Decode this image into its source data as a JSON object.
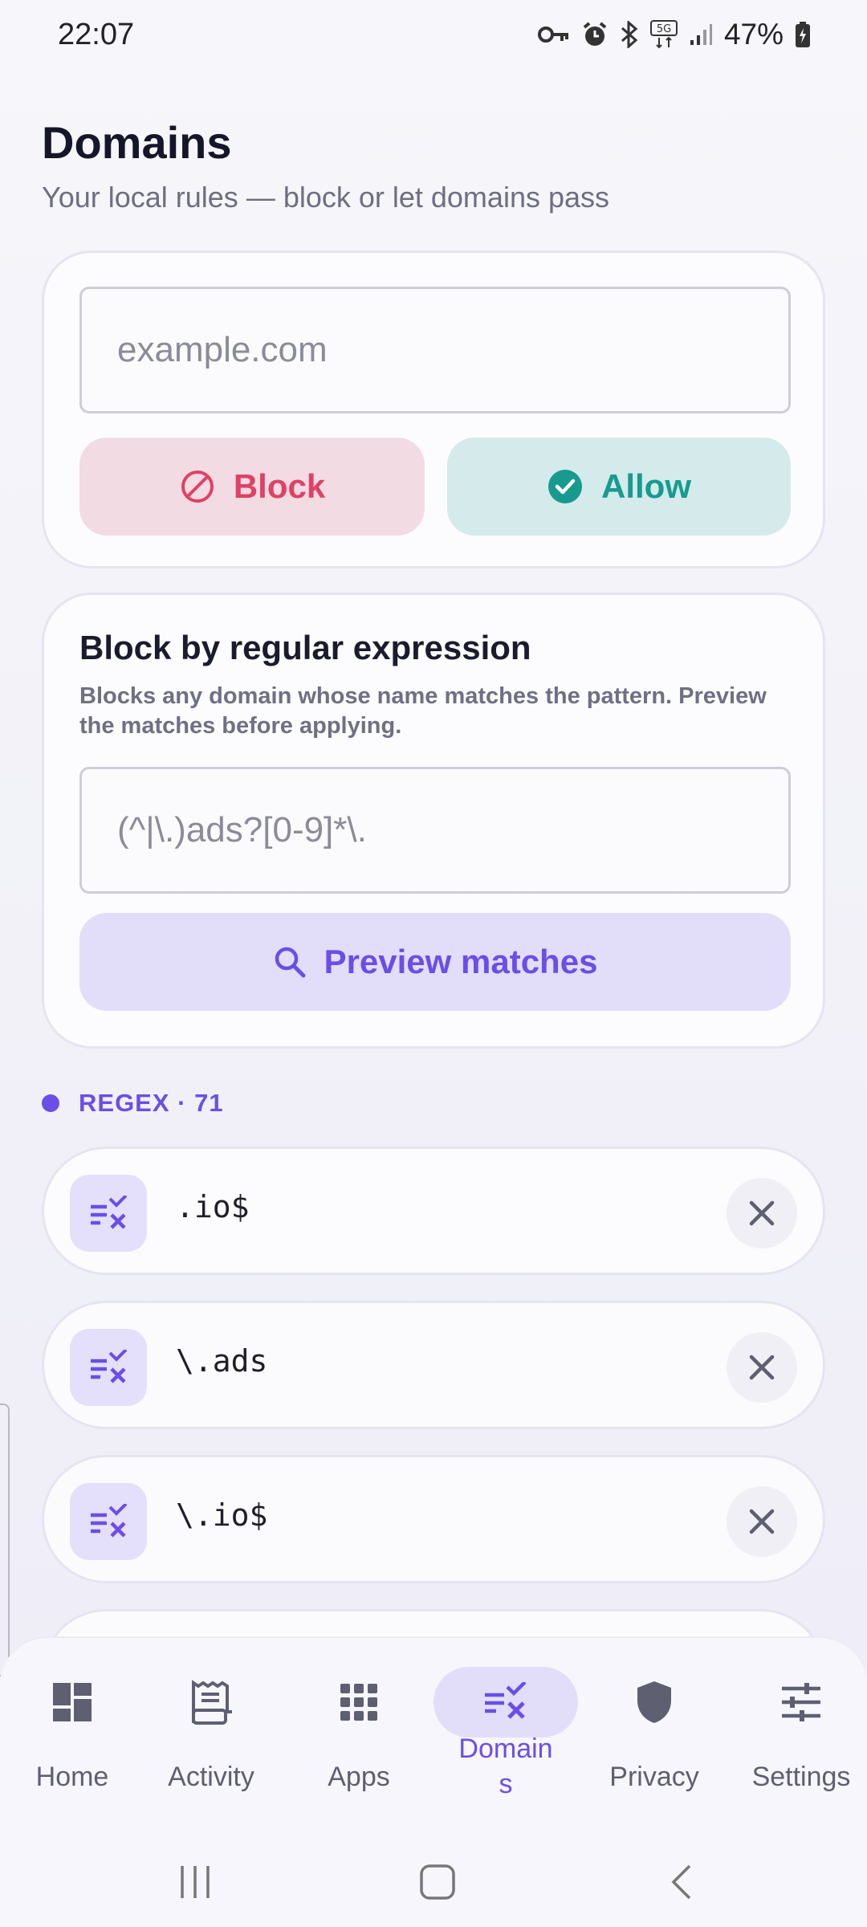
{
  "status_bar": {
    "time": "22:07",
    "network": "5G",
    "battery": "47%",
    "icons": [
      "vpn-key-icon",
      "alarm-icon",
      "bluetooth-icon",
      "5g-icon",
      "signal-icon",
      "battery-charging-icon"
    ]
  },
  "header": {
    "title": "Domains",
    "subtitle": "Your local rules — block or let domains pass"
  },
  "add_card": {
    "domain_placeholder": "example.com",
    "block_label": "Block",
    "allow_label": "Allow"
  },
  "regex_card": {
    "title": "Block by regular expression",
    "description": "Blocks any domain whose name matches the pattern. Preview the matches before applying.",
    "pattern_placeholder": "(^|\\.)ads?[0-9]*\\.",
    "preview_label": "Preview matches"
  },
  "regex_section": {
    "label": "REGEX · 71"
  },
  "rules": [
    {
      "pattern": ".io$"
    },
    {
      "pattern": "\\.ads"
    },
    {
      "pattern": "\\.io$"
    }
  ],
  "bottom_nav": [
    {
      "label": "Home",
      "icon": "dashboard-icon",
      "active": false
    },
    {
      "label": "Activity",
      "icon": "receipt-icon",
      "active": false
    },
    {
      "label": "Apps",
      "icon": "apps-grid-icon",
      "active": false
    },
    {
      "label": "Domains",
      "icon": "rule-icon",
      "active": true
    },
    {
      "label": "Privacy",
      "icon": "shield-icon",
      "active": false
    },
    {
      "label": "Settings",
      "icon": "tune-icon",
      "active": false
    }
  ],
  "colors": {
    "accent": "#6a4ee8",
    "block": "#df4167",
    "allow": "#179b8e"
  }
}
